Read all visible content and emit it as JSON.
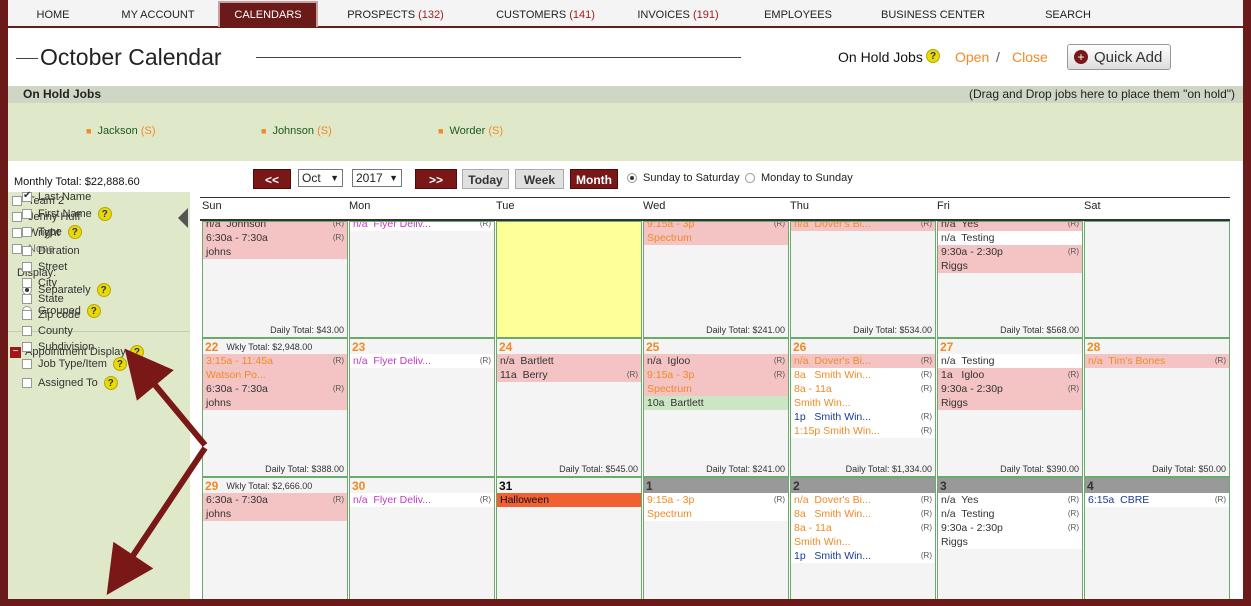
{
  "nav": {
    "items": [
      {
        "label": "HOME",
        "count": ""
      },
      {
        "label": "MY ACCOUNT",
        "count": ""
      },
      {
        "label": "CALENDARS",
        "count": ""
      },
      {
        "label": "PROSPECTS",
        "count": "(132)"
      },
      {
        "label": "CUSTOMERS",
        "count": "(141)"
      },
      {
        "label": "INVOICES",
        "count": "(191)"
      },
      {
        "label": "EMPLOYEES",
        "count": ""
      },
      {
        "label": "BUSINESS CENTER",
        "count": ""
      },
      {
        "label": "SEARCH",
        "count": ""
      }
    ],
    "active": "CALENDARS"
  },
  "header": {
    "title": "October Calendar",
    "on_hold_label": "On Hold Jobs",
    "open": "Open",
    "sep": "/",
    "close": "Close",
    "quick_add": "Quick Add"
  },
  "on_hold": {
    "label": "On Hold Jobs",
    "hint": "(Drag and Drop jobs here to place them \"on hold\")",
    "jobs": [
      {
        "name": "Jackson",
        "tag": "(S)"
      },
      {
        "name": "Johnson",
        "tag": "(S)"
      },
      {
        "name": "Worder",
        "tag": "(S)"
      }
    ]
  },
  "monthly_total": "Monthly Total: $22,888.60",
  "controls": {
    "prev": "<<",
    "month": "Oct",
    "year": "2017",
    "next": ">>",
    "today": "Today",
    "week": "Week",
    "month_btn": "Month",
    "opt1": "Sunday to Saturday",
    "opt2": "Monday to Sunday"
  },
  "sidebar": {
    "employees": [
      "Team 2",
      "Jenny Huff",
      "Wright",
      "None"
    ],
    "display_label": "Display:",
    "display_opts": [
      "Separately",
      "Grouped"
    ],
    "appt_label": "Appointment Display",
    "fields": [
      {
        "label": "Last Name",
        "checked": true,
        "help": false
      },
      {
        "label": "First Name",
        "checked": false,
        "help": true
      },
      {
        "label": "Type",
        "checked": false,
        "help": true
      },
      {
        "label": "Duration",
        "checked": false,
        "help": false
      },
      {
        "label": "Street",
        "checked": false,
        "help": false
      },
      {
        "label": "City",
        "checked": false,
        "help": false
      },
      {
        "label": "State",
        "checked": false,
        "help": false
      },
      {
        "label": "Zip code",
        "checked": false,
        "help": false
      },
      {
        "label": "County",
        "checked": false,
        "help": false
      },
      {
        "label": "Subdivision",
        "checked": false,
        "help": false
      },
      {
        "label": "Job Type/Item",
        "checked": false,
        "help": true
      },
      {
        "label": "Assigned To",
        "checked": false,
        "help": true
      }
    ]
  },
  "days": [
    "Sun",
    "Mon",
    "Tue",
    "Wed",
    "Thu",
    "Fri",
    "Sat"
  ],
  "weeks": [
    {
      "cells": [
        {
          "num": "",
          "wk": "",
          "style": "",
          "events": [
            {
              "t": "n/a  Johnson",
              "r": "(R)",
              "c": "pink dark"
            },
            {
              "t": "6:30a - 7:30a",
              "r": "(R)",
              "c": "pink dark"
            },
            {
              "t": "johns",
              "r": "",
              "c": "pink dark"
            }
          ],
          "total": "Daily Total: $43.00"
        },
        {
          "num": "",
          "wk": "",
          "style": "",
          "events": [
            {
              "t": "n/a  Flyer Deliv...",
              "r": "(R)",
              "c": "white purple"
            }
          ],
          "total": ""
        },
        {
          "num": "",
          "wk": "",
          "style": "yellow",
          "events": [],
          "total": ""
        },
        {
          "num": "",
          "wk": "",
          "style": "",
          "events": [
            {
              "t": "9:15a - 3p",
              "r": "(R)",
              "c": "pink orange"
            },
            {
              "t": "Spectrum",
              "r": "",
              "c": "pink orange"
            }
          ],
          "total": "Daily Total: $241.00"
        },
        {
          "num": "",
          "wk": "",
          "style": "",
          "events": [
            {
              "t": "n/a  Dover's Bi...",
              "r": "(R)",
              "c": "pink orange"
            }
          ],
          "total": "Daily Total: $534.00"
        },
        {
          "num": "",
          "wk": "",
          "style": "",
          "events": [
            {
              "t": "n/a  Yes",
              "r": "(R)",
              "c": "pink dark"
            },
            {
              "t": "n/a  Testing",
              "r": "",
              "c": "white dark"
            },
            {
              "t": "9:30a - 2:30p",
              "r": "(R)",
              "c": "pink dark"
            },
            {
              "t": "Riggs",
              "r": "",
              "c": "pink dark"
            }
          ],
          "total": "Daily Total: $568.00"
        },
        {
          "num": "",
          "wk": "",
          "style": "",
          "events": [],
          "total": ""
        }
      ]
    },
    {
      "cells": [
        {
          "num": "22",
          "wk": "Wkly Total: $2,948.00",
          "style": "",
          "events": [
            {
              "t": "3:15a - 11:45a",
              "r": "(R)",
              "c": "pink orange"
            },
            {
              "t": "Watson Po...",
              "r": "",
              "c": "pink orange"
            },
            {
              "t": "6:30a - 7:30a",
              "r": "(R)",
              "c": "pink dark"
            },
            {
              "t": "johns",
              "r": "",
              "c": "pink dark"
            }
          ],
          "total": "Daily Total: $388.00"
        },
        {
          "num": "23",
          "wk": "",
          "style": "",
          "events": [
            {
              "t": "n/a  Flyer Deliv...",
              "r": "(R)",
              "c": "white purple"
            }
          ],
          "total": ""
        },
        {
          "num": "24",
          "wk": "",
          "style": "",
          "events": [
            {
              "t": "n/a  Bartlett",
              "r": "",
              "c": "pink dark"
            },
            {
              "t": "11a  Berry",
              "r": "(R)",
              "c": "pink dark"
            }
          ],
          "total": "Daily Total: $545.00"
        },
        {
          "num": "25",
          "wk": "",
          "style": "",
          "events": [
            {
              "t": "n/a  Igloo",
              "r": "(R)",
              "c": "pink dark"
            },
            {
              "t": "9:15a - 3p",
              "r": "(R)",
              "c": "pink orange"
            },
            {
              "t": "Spectrum",
              "r": "",
              "c": "pink orange"
            },
            {
              "t": "10a  Bartlett",
              "r": "",
              "c": "green dark"
            }
          ],
          "total": "Daily Total: $241.00"
        },
        {
          "num": "26",
          "wk": "",
          "style": "",
          "events": [
            {
              "t": "n/a  Dover's Bi...",
              "r": "(R)",
              "c": "pink orange"
            },
            {
              "t": "8a   Smith Win...",
              "r": "(R)",
              "c": "white orange"
            },
            {
              "t": "8a - 11a",
              "r": "(R)",
              "c": "white orange"
            },
            {
              "t": "Smith Win...",
              "r": "",
              "c": "white orange"
            },
            {
              "t": "1p   Smith Win...",
              "r": "(R)",
              "c": "white blue"
            },
            {
              "t": "1:15p Smith Win...",
              "r": "(R)",
              "c": "white orange"
            }
          ],
          "total": "Daily Total: $1,334.00"
        },
        {
          "num": "27",
          "wk": "",
          "style": "",
          "events": [
            {
              "t": "n/a  Testing",
              "r": "",
              "c": "white dark"
            },
            {
              "t": "1a   Igloo",
              "r": "(R)",
              "c": "pink dark"
            },
            {
              "t": "9:30a - 2:30p",
              "r": "(R)",
              "c": "pink dark"
            },
            {
              "t": "Riggs",
              "r": "",
              "c": "pink dark"
            }
          ],
          "total": "Daily Total: $390.00"
        },
        {
          "num": "28",
          "wk": "",
          "style": "",
          "events": [
            {
              "t": "n/a  Tim's Bones",
              "r": "(R)",
              "c": "pink orange"
            }
          ],
          "total": "Daily Total: $50.00"
        }
      ]
    },
    {
      "cells": [
        {
          "num": "29",
          "wk": "Wkly Total: $2,666.00",
          "style": "",
          "events": [
            {
              "t": "6:30a - 7:30a",
              "r": "(R)",
              "c": "pink dark"
            },
            {
              "t": "johns",
              "r": "",
              "c": "pink dark"
            }
          ],
          "total": ""
        },
        {
          "num": "30",
          "wk": "",
          "style": "",
          "events": [
            {
              "t": "n/a  Flyer Deliv...",
              "r": "(R)",
              "c": "white purple"
            }
          ],
          "total": ""
        },
        {
          "num": "31",
          "wk": "",
          "style": "black",
          "events": [
            {
              "t": "Halloween",
              "r": "",
              "c": "halloween"
            }
          ],
          "total": ""
        },
        {
          "num": "1",
          "wk": "",
          "style": "gray",
          "events": [
            {
              "t": "9:15a - 3p",
              "r": "(R)",
              "c": "white orange"
            },
            {
              "t": "Spectrum",
              "r": "",
              "c": "white orange"
            }
          ],
          "total": ""
        },
        {
          "num": "2",
          "wk": "",
          "style": "gray",
          "events": [
            {
              "t": "n/a  Dover's Bi...",
              "r": "(R)",
              "c": "white orange"
            },
            {
              "t": "8a   Smith Win...",
              "r": "(R)",
              "c": "white orange"
            },
            {
              "t": "8a - 11a",
              "r": "(R)",
              "c": "white orange"
            },
            {
              "t": "Smith Win...",
              "r": "",
              "c": "white orange"
            },
            {
              "t": "1p   Smith Win...",
              "r": "(R)",
              "c": "white blue"
            }
          ],
          "total": ""
        },
        {
          "num": "3",
          "wk": "",
          "style": "gray",
          "events": [
            {
              "t": "n/a  Yes",
              "r": "(R)",
              "c": "white dark"
            },
            {
              "t": "n/a  Testing",
              "r": "(R)",
              "c": "white dark"
            },
            {
              "t": "9:30a - 2:30p",
              "r": "(R)",
              "c": "white dark"
            },
            {
              "t": "Riggs",
              "r": "",
              "c": "white dark"
            }
          ],
          "total": ""
        },
        {
          "num": "4",
          "wk": "",
          "style": "gray",
          "events": [
            {
              "t": "6:15a  CBRE",
              "r": "(R)",
              "c": "white blue"
            }
          ],
          "total": ""
        }
      ]
    }
  ]
}
